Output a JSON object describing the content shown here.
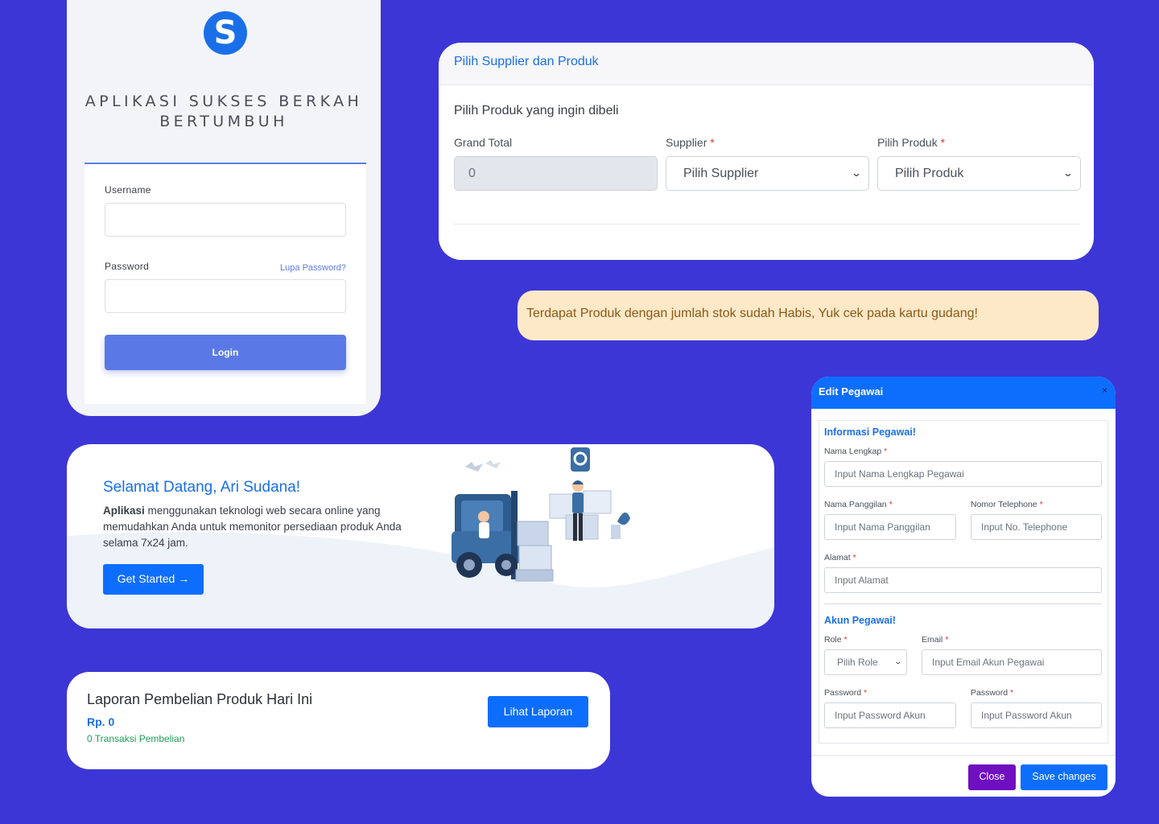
{
  "login": {
    "logo_letter": "S",
    "app_title_line1": "APLIKASI SUKSES BERKAH",
    "app_title_line2": "BERTUMBUH",
    "username_label": "Username",
    "password_label": "Password",
    "forgot_link": "Lupa Password?",
    "login_button": "Login",
    "username_value": "",
    "password_value": ""
  },
  "supplier": {
    "header": "Pilih Supplier dan Produk",
    "subtitle": "Pilih Produk yang ingin dibeli",
    "grand_total_label": "Grand Total",
    "grand_total_value": "0",
    "supplier_label": "Supplier",
    "supplier_selected": "Pilih Supplier",
    "produk_label": "Pilih Produk",
    "produk_selected": "Pilih Produk",
    "required_mark": "*"
  },
  "alert": {
    "text": "Terdapat Produk dengan jumlah stok sudah Habis, Yuk cek pada kartu gudang!"
  },
  "welcome": {
    "title": "Selamat Datang, Ari Sudana!",
    "text_bold": "Aplikasi",
    "text_rest": " menggunakan teknologi web secara online yang memudahkan Anda untuk memonitor persediaan produk Anda selama 7x24 jam.",
    "button": "Get Started →"
  },
  "laporan": {
    "title": "Laporan Pembelian Produk Hari Ini",
    "amount": "Rp. 0",
    "transactions": "0 Transaksi Pembelian",
    "button": "Lihat Laporan"
  },
  "modal": {
    "title": "Edit Pegawai",
    "close_icon": "×",
    "section_info": "Informasi Pegawai!",
    "nama_label": "Nama Lengkap",
    "nama_placeholder": "Input Nama Lengkap Pegawai",
    "panggilan_label": "Nama Panggilan",
    "panggilan_placeholder": "Input Nama Panggilan",
    "telepon_label": "Nomor Telephone",
    "telepon_placeholder": "Input No. Telephone",
    "alamat_label": "Alamat",
    "alamat_placeholder": "Input Alamat",
    "section_akun": "Akun Pegawai!",
    "role_label": "Role",
    "role_selected": "Pilih Role",
    "email_label": "Email",
    "email_placeholder": "Input Email Akun Pegawai",
    "password_label": "Password",
    "password_placeholder": "Input Password Akun",
    "password2_label": "Password",
    "password2_placeholder": "Input Password Akun",
    "required_mark": "*",
    "close_button": "Close",
    "save_button": "Save changes"
  },
  "colors": {
    "background": "#3c36d6",
    "primary": "#0d6efd",
    "login_button": "#5b79e6",
    "alert_bg": "#fde8c8",
    "close_button": "#6f0fc0",
    "success_text": "#1e9e58"
  }
}
